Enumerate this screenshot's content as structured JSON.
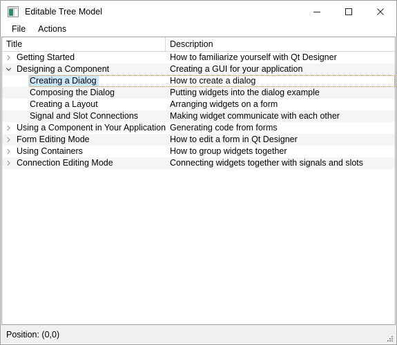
{
  "window": {
    "title": "Editable Tree Model",
    "icon": "application-window-icon",
    "controls": {
      "minimize": "minimize-icon",
      "maximize": "maximize-icon",
      "close": "close-icon"
    }
  },
  "menu": {
    "items": [
      {
        "label": "File"
      },
      {
        "label": "Actions"
      }
    ]
  },
  "tree": {
    "columns": [
      {
        "label": "Title"
      },
      {
        "label": "Description"
      }
    ],
    "rows": [
      {
        "title": "Getting Started",
        "description": "How to familiarize yourself with Qt Designer",
        "depth": 0,
        "branch": "collapsed",
        "alt": false,
        "selected": false
      },
      {
        "title": "Designing a Component",
        "description": "Creating a GUI for your application",
        "depth": 0,
        "branch": "expanded",
        "alt": true,
        "selected": false
      },
      {
        "title": "Creating a Dialog",
        "description": "How to create a dialog",
        "depth": 1,
        "branch": "none",
        "alt": false,
        "selected": true
      },
      {
        "title": "Composing the Dialog",
        "description": "Putting widgets into the dialog example",
        "depth": 1,
        "branch": "none",
        "alt": true,
        "selected": false
      },
      {
        "title": "Creating a Layout",
        "description": "Arranging widgets on a form",
        "depth": 1,
        "branch": "none",
        "alt": false,
        "selected": false
      },
      {
        "title": "Signal and Slot Connections",
        "description": "Making widget communicate with each other",
        "depth": 1,
        "branch": "none",
        "alt": true,
        "selected": false
      },
      {
        "title": "Using a Component in Your Application",
        "description": "Generating code from forms",
        "depth": 0,
        "branch": "collapsed",
        "alt": false,
        "selected": false
      },
      {
        "title": "Form Editing Mode",
        "description": "How to edit a form in Qt Designer",
        "depth": 0,
        "branch": "collapsed",
        "alt": true,
        "selected": false
      },
      {
        "title": "Using Containers",
        "description": "How to group widgets together",
        "depth": 0,
        "branch": "collapsed",
        "alt": false,
        "selected": false
      },
      {
        "title": "Connection Editing Mode",
        "description": "Connecting widgets together with signals and slots",
        "depth": 0,
        "branch": "collapsed",
        "alt": true,
        "selected": false
      }
    ]
  },
  "status": {
    "text": "Position: (0,0)",
    "grip": "resize-grip-icon"
  },
  "colors": {
    "selection": "#cce8ff",
    "focus_outline": "#e08020",
    "alt_row": "#f5f5f5",
    "status_bar": "#f0f0f0",
    "window_border": "#9a9a9a"
  }
}
